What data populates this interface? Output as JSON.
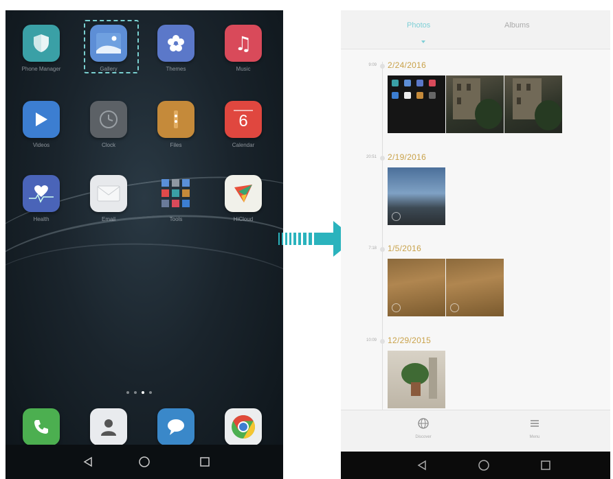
{
  "home": {
    "apps": [
      {
        "name": "Phone Manager",
        "icon": "shield-icon"
      },
      {
        "name": "Gallery",
        "icon": "gallery-icon"
      },
      {
        "name": "Themes",
        "icon": "themes-icon"
      },
      {
        "name": "Music",
        "icon": "music-icon"
      },
      {
        "name": "Videos",
        "icon": "videos-icon"
      },
      {
        "name": "Clock",
        "icon": "clock-icon"
      },
      {
        "name": "Files",
        "icon": "files-icon"
      },
      {
        "name": "Calendar",
        "icon": "calendar-icon",
        "day": "6"
      },
      {
        "name": "Health",
        "icon": "health-icon"
      },
      {
        "name": "Email",
        "icon": "email-icon"
      },
      {
        "name": "Tools",
        "icon": "folder-icon"
      },
      {
        "name": "HiCloud",
        "icon": "hicloud-icon"
      }
    ],
    "dock": [
      {
        "icon": "phone-icon"
      },
      {
        "icon": "contacts-icon"
      },
      {
        "icon": "messaging-icon"
      },
      {
        "icon": "chrome-icon"
      }
    ],
    "page_dots": 4,
    "active_page": 3
  },
  "gallery": {
    "tabs": [
      "Photos",
      "Albums"
    ],
    "active_tab": 0,
    "sections": [
      {
        "time": "9:09",
        "date": "2/24/2016",
        "photos": 3
      },
      {
        "time": "20:51",
        "date": "2/19/2016",
        "photos": 1
      },
      {
        "time": "7:18",
        "date": "1/5/2016",
        "photos": 2
      },
      {
        "time": "10:09",
        "date": "12/29/2015",
        "photos": 1
      }
    ],
    "bottom": [
      {
        "label": "Discover",
        "icon": "globe-icon"
      },
      {
        "label": "Menu",
        "icon": "menu-icon"
      }
    ]
  },
  "colors": {
    "accent": "#7fcfd6",
    "date": "#c9a24a",
    "arrow": "#2bb3bd"
  }
}
